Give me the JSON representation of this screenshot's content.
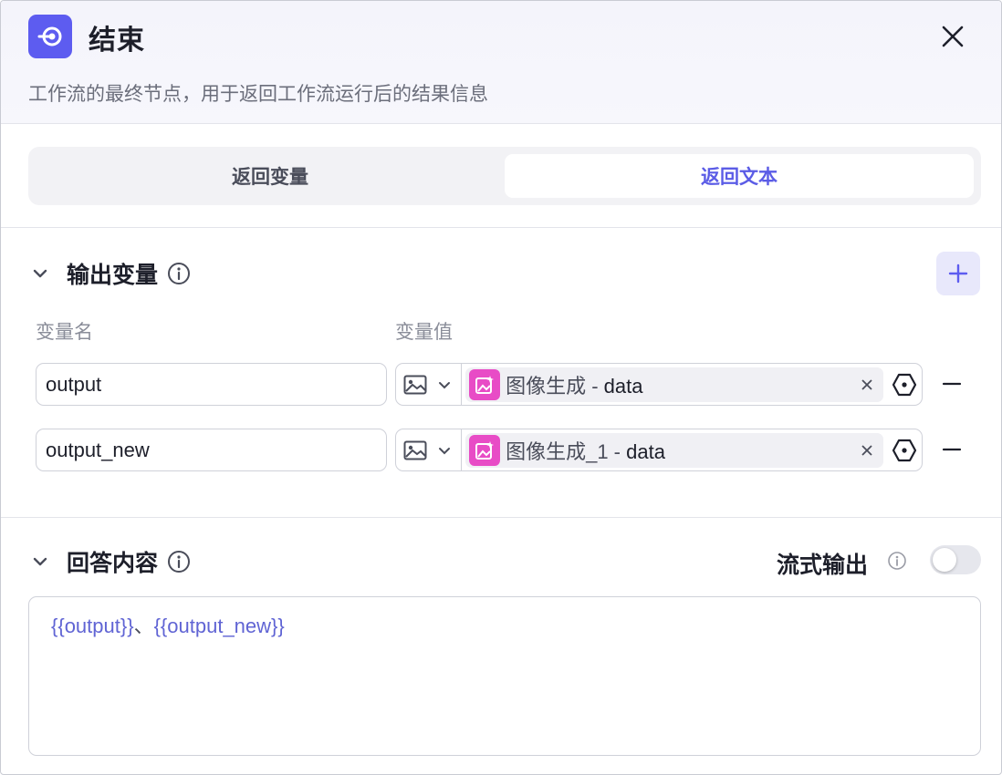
{
  "header": {
    "title": "结束",
    "description": "工作流的最终节点，用于返回工作流运行后的结果信息",
    "icon": "end-node-icon"
  },
  "tabs": [
    {
      "label": "返回变量",
      "active": false
    },
    {
      "label": "返回文本",
      "active": true
    }
  ],
  "output_section": {
    "title": "输出变量",
    "col_name": "变量名",
    "col_value": "变量值",
    "rows": [
      {
        "name": "output",
        "ref_node": "图像生成",
        "ref_sep": " - ",
        "ref_field": "data",
        "type_icon": "image-icon"
      },
      {
        "name": "output_new",
        "ref_node": "图像生成_1",
        "ref_sep": " - ",
        "ref_field": "data",
        "type_icon": "image-icon"
      }
    ]
  },
  "answer_section": {
    "title": "回答内容",
    "stream_label": "流式输出",
    "stream_enabled": false,
    "content_a": "{{output}}",
    "content_sep": "、",
    "content_b": "{{output_new}}"
  },
  "colors": {
    "accent": "#5d5cf0",
    "ref_icon": "#e84cc6",
    "tab_active_text": "#5b5ce6"
  }
}
